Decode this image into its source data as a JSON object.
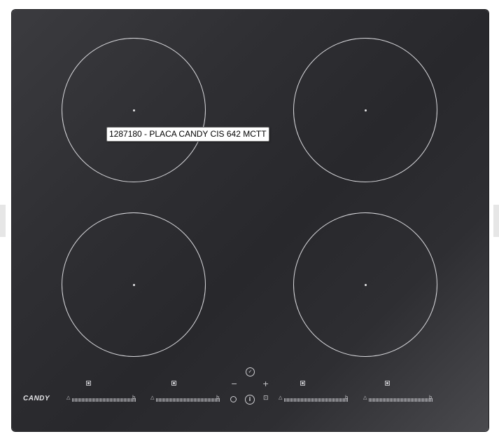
{
  "tooltip": {
    "text": "1287180 - PLACA CANDY CIS 642 MCTT"
  },
  "hob": {
    "brand": "CANDY",
    "zones": [
      "front-left",
      "rear-left",
      "front-right",
      "rear-right"
    ],
    "controls": {
      "minus": "−",
      "plus": "+",
      "check": "✓",
      "power": "i",
      "lock": "🔒"
    },
    "slider_end_glyph": "b",
    "colors": {
      "glass": "#2f2f33",
      "rings": "#d9d9dd"
    }
  }
}
